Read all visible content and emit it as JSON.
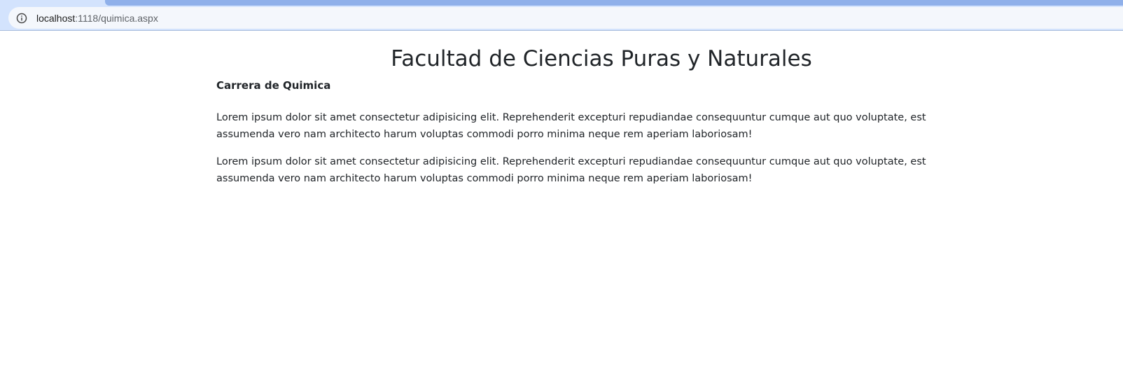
{
  "browser": {
    "url_host": "localhost",
    "url_rest": ":1118/quimica.aspx",
    "site_info_icon": "info-circle-icon"
  },
  "main": {
    "title": "Facultad de Ciencias Puras y Naturales",
    "subtitle": "Carrera de Quimica",
    "paragraphs": [
      "Lorem ipsum dolor sit amet consectetur adipisicing elit. Reprehenderit excepturi repudiandae consequuntur cumque aut quo voluptate, est assumenda vero nam architecto harum voluptas commodi porro minima neque rem aperiam laboriosam!",
      "Lorem ipsum dolor sit amet consectetur adipisicing elit. Reprehenderit excepturi repudiandae consequuntur cumque aut quo voluptate, est assumenda vero nam architecto harum voluptas commodi porro minima neque rem aperiam laboriosam!"
    ]
  },
  "colors": {
    "browser_chrome": "#d3e3fd",
    "address_bar": "#f4f7fc",
    "text": "#212529"
  }
}
